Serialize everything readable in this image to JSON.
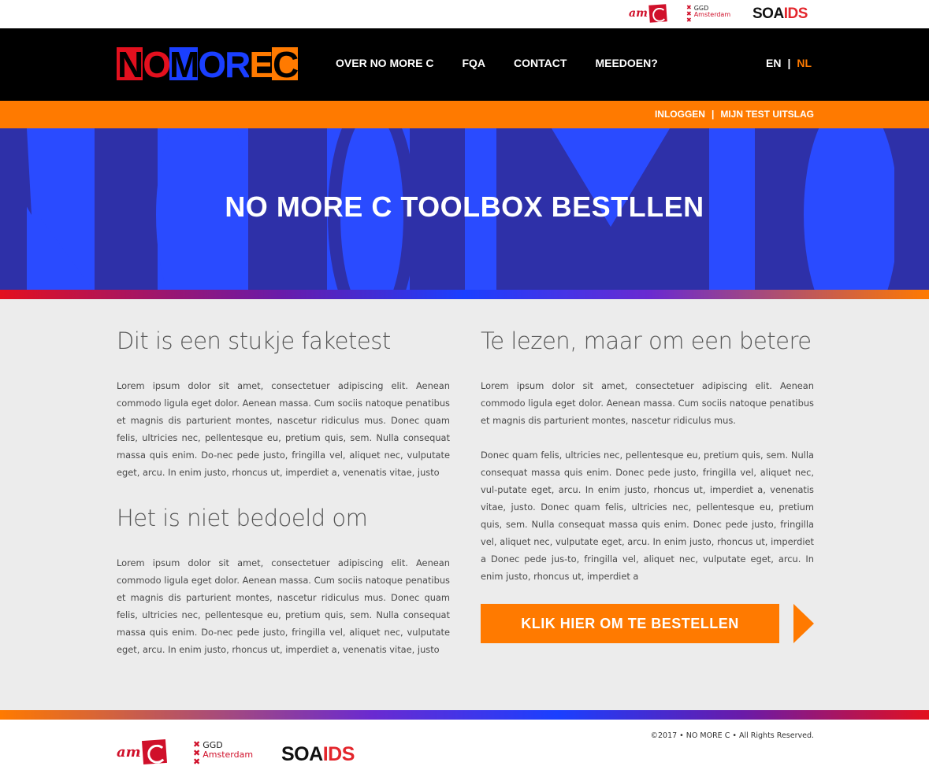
{
  "partners": {
    "amc": {
      "text": "am"
    },
    "ggd": {
      "line1": "GGD",
      "line2": "Amsterdam",
      "cross": "✖"
    },
    "soaids": {
      "part1": "SOA",
      "part2": "IDS"
    }
  },
  "header": {
    "brand_letters": [
      "N",
      "O",
      "M",
      "O",
      "R",
      "E",
      "C"
    ],
    "nav": [
      "OVER NO MORE C",
      "FQA",
      "CONTACT",
      "MEEDOEN?"
    ],
    "lang": {
      "en": "EN",
      "sep": "|",
      "nl": "NL",
      "active": "NL"
    }
  },
  "subbar": {
    "login": "INLOGGEN",
    "sep": "|",
    "results": "MIJN TEST UITSLAG"
  },
  "hero": {
    "title": "NO MORE C TOOLBOX BESTLLEN"
  },
  "left": {
    "heading1": "Dit is een stukje faketest",
    "para1": "Lorem ipsum dolor sit amet, consectetuer adipiscing elit. Aenean commodo ligula eget dolor. Aenean massa. Cum sociis natoque penatibus et magnis dis parturient montes, nascetur ridiculus mus. Donec quam felis, ultricies nec, pellentesque eu, pretium quis, sem. Nulla consequat massa quis enim. Do-nec pede justo, fringilla vel, aliquet nec, vulputate eget, arcu. In enim justo, rhoncus ut, imperdiet a, venenatis vitae, justo",
    "heading2": "Het is niet bedoeld om",
    "para2": "Lorem ipsum dolor sit amet, consectetuer adipiscing elit. Aenean commodo ligula eget dolor. Aenean massa. Cum sociis natoque penatibus et magnis dis parturient montes, nascetur ridiculus mus. Donec quam felis, ultricies nec, pellentesque eu, pretium quis, sem. Nulla consequat massa quis enim. Do-nec pede justo, fringilla vel, aliquet nec, vulputate eget, arcu. In enim justo, rhoncus ut, imperdiet a, venenatis vitae, justo"
  },
  "right": {
    "heading": "Te lezen, maar om een betere",
    "para1": "Lorem ipsum dolor sit amet, consectetuer adipiscing elit. Aenean commodo ligula eget dolor. Aenean massa. Cum sociis natoque penatibus et magnis dis parturient montes, nascetur ridiculus mus.",
    "para2": "Donec quam felis, ultricies nec, pellentesque eu, pretium quis, sem. Nulla consequat massa quis enim. Donec pede justo, fringilla vel, aliquet nec, vul-putate eget, arcu. In enim justo, rhoncus ut, imperdiet a, venenatis vitae, justo. Donec quam felis, ultricies nec, pellentesque eu, pretium quis, sem. Nulla consequat massa quis enim. Donec pede justo, fringilla vel, aliquet nec, vulputate eget, arcu. In enim justo, rhoncus ut, imperdiet a Donec pede jus-to, fringilla vel, aliquet nec, vulputate eget, arcu. In enim justo, rhoncus ut, imperdiet a",
    "cta": "KLIK HIER OM TE BESTELLEN"
  },
  "footer": {
    "copyright": "©2017 • NO MORE C  • All Rights Reserved."
  },
  "colors": {
    "orange": "#ff7a00",
    "blue": "#2a4bff",
    "red": "#e3101e",
    "black": "#000000",
    "content_bg": "#ececec"
  }
}
